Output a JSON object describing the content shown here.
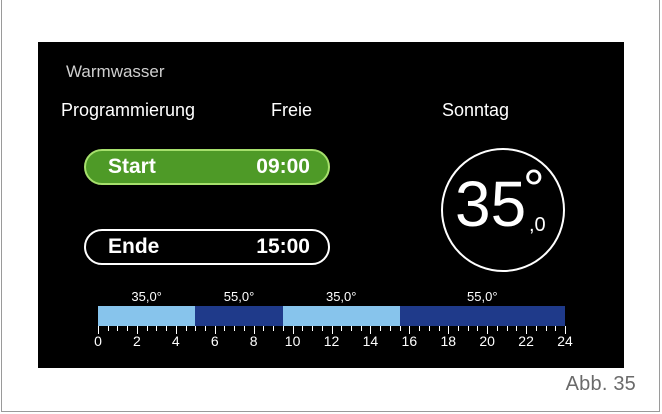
{
  "figure": {
    "caption": "Abb. 35"
  },
  "screen": {
    "title": "Warmwasser",
    "mode_label": "Programmierung",
    "mode_value": "Freie",
    "day": "Sonntag",
    "start": {
      "label": "Start",
      "time": "09:00"
    },
    "end": {
      "label": "Ende",
      "time": "15:00"
    },
    "temperature": {
      "integer": "35",
      "degree": "°",
      "decimal": ",0"
    },
    "schedule": {
      "axis_min": 0,
      "axis_max": 24,
      "hour_labels": [
        "0",
        "2",
        "4",
        "6",
        "8",
        "10",
        "12",
        "14",
        "16",
        "18",
        "20",
        "22",
        "24"
      ],
      "segments": [
        {
          "start": 0,
          "end": 5,
          "label": "35,0°",
          "color": "#87c4ec"
        },
        {
          "start": 5,
          "end": 9.5,
          "label": "55,0°",
          "color": "#1f3a8a"
        },
        {
          "start": 9.5,
          "end": 15.5,
          "label": "35,0°",
          "color": "#87c4ec"
        },
        {
          "start": 15.5,
          "end": 24,
          "label": "55,0°",
          "color": "#1f3a8a"
        }
      ]
    }
  },
  "colors": {
    "active_pill": "#4e9a27",
    "active_pill_border": "#a6e06c",
    "low_temp": "#87c4ec",
    "high_temp": "#1f3a8a"
  }
}
